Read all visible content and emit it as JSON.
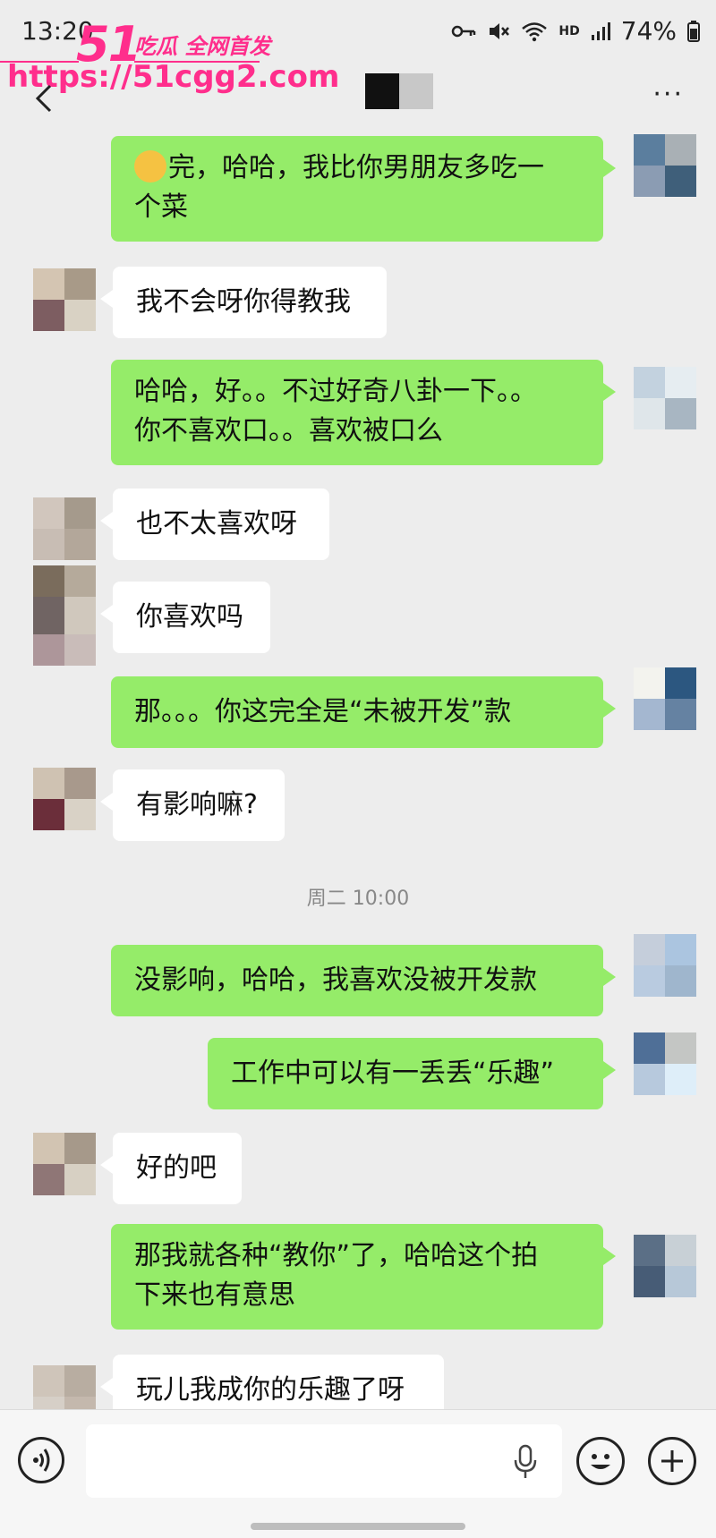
{
  "status_bar": {
    "time": "13:20",
    "battery": "74%",
    "hd_label": "HD"
  },
  "watermark": {
    "big": "51",
    "tag": "吃瓜 全网首发",
    "url": "https://51cgg2.com"
  },
  "header": {
    "more": "···"
  },
  "messages": [
    {
      "side": "me",
      "lines": [
        "完，哈哈，我比你男朋友多吃一",
        "个菜"
      ],
      "emoji": true
    },
    {
      "side": "other",
      "lines": [
        "我不会呀你得教我"
      ]
    },
    {
      "side": "me",
      "lines": [
        "哈哈，好。。不过好奇八卦一下。。",
        "你不喜欢口。。喜欢被口么"
      ]
    },
    {
      "side": "other",
      "lines": [
        "也不太喜欢呀"
      ]
    },
    {
      "side": "other",
      "lines": [
        "你喜欢吗"
      ]
    },
    {
      "side": "me",
      "lines": [
        "那。。。你这完全是“未被开发”款"
      ]
    },
    {
      "side": "other",
      "lines": [
        "有影响嘛?"
      ]
    },
    {
      "side": "me",
      "lines": [
        "没影响，哈哈，我喜欢没被开发款"
      ]
    },
    {
      "side": "me",
      "lines": [
        "工作中可以有一丢丢“乐趣”"
      ]
    },
    {
      "side": "other",
      "lines": [
        "好的吧"
      ]
    },
    {
      "side": "me",
      "lines": [
        "那我就各种“教你”了，哈哈这个拍",
        "下来也有意思"
      ]
    },
    {
      "side": "other",
      "lines": [
        "玩儿我成你的乐趣了呀"
      ]
    }
  ],
  "timestamp": "周二 10:00",
  "input": {
    "value": "",
    "placeholder": ""
  },
  "colors": {
    "background": "#ededed",
    "my_bubble": "#95ec69",
    "their_bubble": "#ffffff",
    "watermark": "#ff2e8c"
  }
}
